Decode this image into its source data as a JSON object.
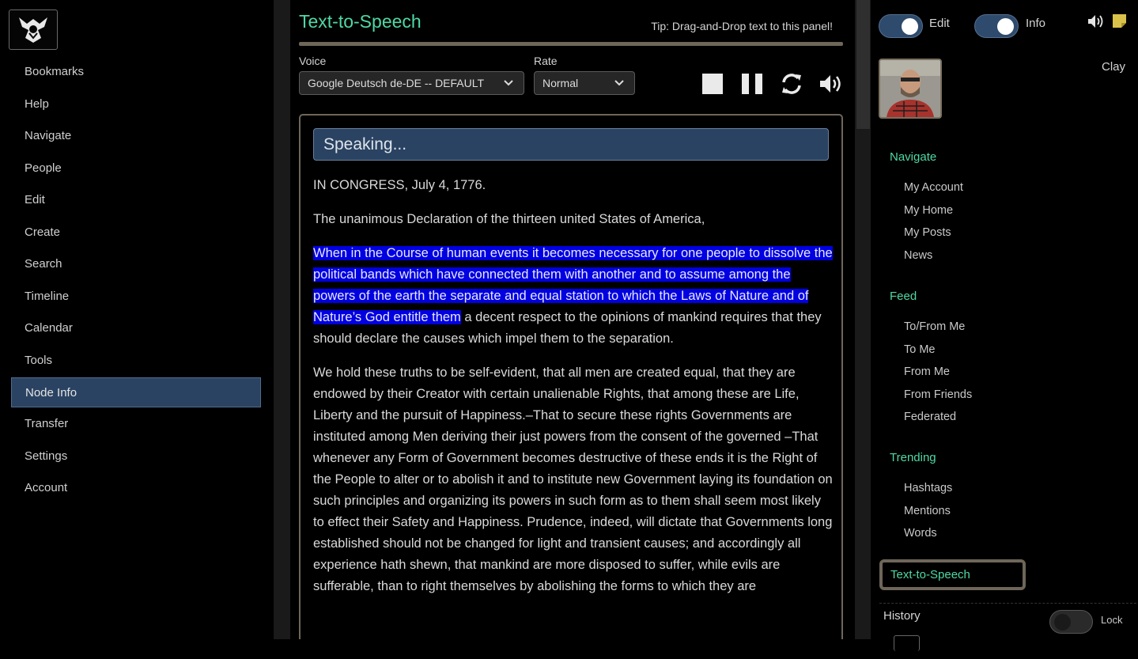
{
  "left_menu": {
    "items": [
      {
        "label": "Bookmarks"
      },
      {
        "label": "Help"
      },
      {
        "label": "Navigate"
      },
      {
        "label": "People"
      },
      {
        "label": "Edit"
      },
      {
        "label": "Create"
      },
      {
        "label": "Search"
      },
      {
        "label": "Timeline"
      },
      {
        "label": "Calendar"
      },
      {
        "label": "Tools"
      },
      {
        "label": "Node Info",
        "active": true
      },
      {
        "label": "Transfer"
      },
      {
        "label": "Settings"
      },
      {
        "label": "Account"
      }
    ]
  },
  "tts": {
    "title": "Text-to-Speech",
    "tip": "Tip: Drag-and-Drop text to this panel!",
    "voice_label": "Voice",
    "voice_value": "Google Deutsch de-DE -- DEFAULT",
    "rate_label": "Rate",
    "rate_value": "Normal",
    "status": "Speaking...",
    "paragraphs": {
      "p1": "IN CONGRESS, July 4, 1776.",
      "p2": "The unanimous Declaration of the thirteen united States of America,",
      "p3_highlight": "When in the Course of human events it becomes necessary for one people to dissolve the political bands which have connected them with another and to assume among the powers of the earth the separate and equal station to which the Laws of Nature and of Nature’s God entitle them",
      "p3_rest": " a decent respect to the opinions of mankind requires that they should declare the causes which impel them to the separation.",
      "p4": "We hold these truths to be self-evident, that all men are created equal, that they are endowed by their Creator with certain unalienable Rights, that among these are Life, Liberty and the pursuit of Happiness.–That to secure these rights Governments are instituted among Men deriving their just powers from the consent of the governed –That whenever any Form of Government becomes destructive of these ends it is the Right of the People to alter or to abolish it and to institute new Government laying its foundation on such principles and organizing its powers in such form as to them shall seem most likely to effect their Safety and Happiness. Prudence, indeed, will dictate that Governments long established should not be changed for light and transient causes; and accordingly all experience hath shewn, that mankind are more disposed to suffer, while evils are sufferable, than to right themselves by abolishing the forms to which they are"
    },
    "controls": [
      "stop-icon",
      "pause-icon",
      "refresh-icon",
      "volume-icon"
    ]
  },
  "right_panel": {
    "edit_label": "Edit",
    "info_label": "Info",
    "username": "Clay",
    "navigate": {
      "heading": "Navigate",
      "links": [
        "My Account",
        "My Home",
        "My Posts",
        "News"
      ]
    },
    "feed": {
      "heading": "Feed",
      "links": [
        "To/From Me",
        "To Me",
        "From Me",
        "From Friends",
        "Federated"
      ]
    },
    "trending": {
      "heading": "Trending",
      "links": [
        "Hashtags",
        "Mentions",
        "Words"
      ]
    },
    "tts_link": "Text-to-Speech",
    "history_label": "History",
    "lock_label": "Lock"
  },
  "colors": {
    "accent_green": "#4fd9a4",
    "active_blue": "#2a4362",
    "highlight": "#0000e0",
    "frame_tan": "#6e6659"
  }
}
